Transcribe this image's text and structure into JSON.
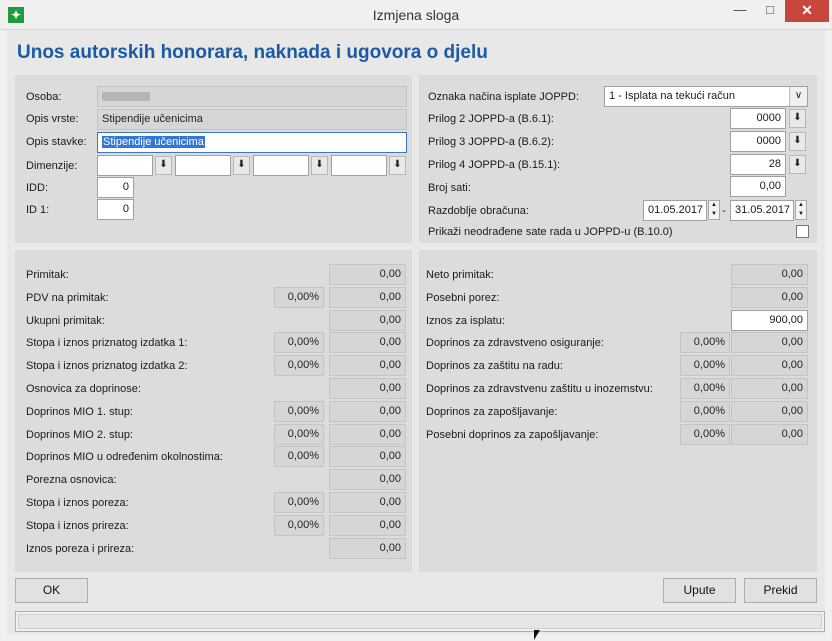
{
  "window": {
    "title": "Izmjena sloga",
    "minimize": "—",
    "maximize": "□",
    "close": "✕",
    "icon": "app-icon"
  },
  "heading": "Unos autorskih honorara, naknada i ugovora o djelu",
  "top_left": {
    "osoba_label": "Osoba:",
    "opis_vrste_label": "Opis vrste:",
    "opis_vrste_value": "Stipendije učenicima",
    "opis_stavke_label": "Opis stavke:",
    "opis_stavke_value": "Stipendije učenicima",
    "dimenzije_label": "Dimenzije:",
    "idd_label": "IDD:",
    "idd_value": "0",
    "id1_label": "ID 1:",
    "id1_value": "0"
  },
  "top_right": {
    "oznaka_label": "Oznaka načina isplate JOPPD:",
    "oznaka_value": "1 - Isplata na tekući račun",
    "prilog2_label": "Prilog 2 JOPPD-a (B.6.1):",
    "prilog2_value": "0000",
    "prilog3_label": "Prilog 3 JOPPD-a (B.6.2):",
    "prilog3_value": "0000",
    "prilog4_label": "Prilog 4 JOPPD-a (B.15.1):",
    "prilog4_value": "28",
    "broj_sati_label": "Broj sati:",
    "broj_sati_value": "0,00",
    "razdoblje_label": "Razdoblje obračuna:",
    "razdoblje_od": "01.05.2017",
    "razdoblje_sep": "-",
    "razdoblje_do": "31.05.2017",
    "prikazi_label": "Prikaži neodrađene sate rada u JOPPD-u (B.10.0)"
  },
  "bottom_left": {
    "rows": [
      {
        "label": "Primitak:",
        "pct": "",
        "value": "0,00"
      },
      {
        "label": "PDV na primitak:",
        "pct": "0,00%",
        "value": "0,00"
      },
      {
        "label": "Ukupni primitak:",
        "pct": "",
        "value": "0,00"
      },
      {
        "label": "Stopa i iznos priznatog izdatka 1:",
        "pct": "0,00%",
        "value": "0,00"
      },
      {
        "label": "Stopa i iznos priznatog izdatka 2:",
        "pct": "0,00%",
        "value": "0,00"
      },
      {
        "label": "Osnovica za doprinose:",
        "pct": "",
        "value": "0,00"
      },
      {
        "label": "Doprinos MIO 1. stup:",
        "pct": "0,00%",
        "value": "0,00"
      },
      {
        "label": "Doprinos MIO 2. stup:",
        "pct": "0,00%",
        "value": "0,00"
      },
      {
        "label": "Doprinos MIO u određenim okolnostima:",
        "pct": "0,00%",
        "value": "0,00"
      },
      {
        "label": "Porezna osnovica:",
        "pct": "",
        "value": "0,00"
      },
      {
        "label": "Stopa i iznos poreza:",
        "pct": "0,00%",
        "value": "0,00"
      },
      {
        "label": "Stopa i iznos prireza:",
        "pct": "0,00%",
        "value": "0,00"
      },
      {
        "label": "Iznos poreza i prireza:",
        "pct": "",
        "value": "0,00"
      }
    ]
  },
  "bottom_right": {
    "rows": [
      {
        "label": "Neto primitak:",
        "pct": "",
        "value": "0,00"
      },
      {
        "label": "Posebni porez:",
        "pct": "",
        "value": "0,00"
      },
      {
        "label": "Iznos za isplatu:",
        "pct": "",
        "value": "900,00"
      },
      {
        "label": "Doprinos za zdravstveno osiguranje:",
        "pct": "0,00%",
        "value": "0,00"
      },
      {
        "label": "Doprinos za zaštitu na radu:",
        "pct": "0,00%",
        "value": "0,00"
      },
      {
        "label": "Doprinos za zdravstvenu zaštitu u inozemstvu:",
        "pct": "0,00%",
        "value": "0,00"
      },
      {
        "label": "Doprinos za zapošljavanje:",
        "pct": "0,00%",
        "value": "0,00"
      },
      {
        "label": "Posebni doprinos za zapošljavanje:",
        "pct": "0,00%",
        "value": "0,00"
      }
    ]
  },
  "buttons": {
    "ok": "OK",
    "upute": "Upute",
    "prekid": "Prekid"
  },
  "picker_glyph": "⬇",
  "combo_glyph": "∨"
}
